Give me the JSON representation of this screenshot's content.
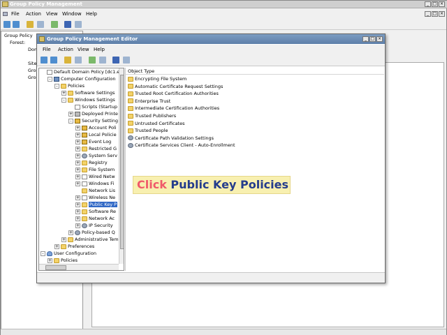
{
  "outer": {
    "title": "Group Policy Management",
    "menu": [
      "File",
      "Action",
      "View",
      "Window",
      "Help"
    ],
    "tree": [
      "Group Policy",
      "Forest:",
      "Dom",
      "Sites",
      "Grou",
      "Grou"
    ]
  },
  "editor": {
    "title": "Group Policy Management Editor",
    "menu": [
      "File",
      "Action",
      "View",
      "Help"
    ],
    "tree": [
      {
        "label": "Default Domain Policy [dc1.es-n",
        "icon": "doc",
        "exp": ""
      },
      {
        "label": "Computer Configuration",
        "icon": "pc",
        "exp": "-"
      },
      {
        "label": "Policies",
        "icon": "folder",
        "exp": "-"
      },
      {
        "label": "Software Settings",
        "icon": "folder",
        "exp": "+"
      },
      {
        "label": "Windows Settings",
        "icon": "folder",
        "exp": "-"
      },
      {
        "label": "Scripts (Startup",
        "icon": "doc",
        "exp": ""
      },
      {
        "label": "Deployed Printe",
        "icon": "printer",
        "exp": "+"
      },
      {
        "label": "Security Setting",
        "icon": "shield",
        "exp": "-"
      },
      {
        "label": "Account Poli",
        "icon": "shield",
        "exp": "+"
      },
      {
        "label": "Local Policie",
        "icon": "shield",
        "exp": "+"
      },
      {
        "label": "Event Log",
        "icon": "shield",
        "exp": "+"
      },
      {
        "label": "Restricted G",
        "icon": "folder",
        "exp": "+"
      },
      {
        "label": "System Serv",
        "icon": "gear",
        "exp": "+"
      },
      {
        "label": "Registry",
        "icon": "folder",
        "exp": "+"
      },
      {
        "label": "File System",
        "icon": "folder",
        "exp": "+"
      },
      {
        "label": "Wired Netw",
        "icon": "doc",
        "exp": "+"
      },
      {
        "label": "Windows Fi",
        "icon": "doc",
        "exp": "+"
      },
      {
        "label": "Network Lis",
        "icon": "folder",
        "exp": ""
      },
      {
        "label": "Wireless Ne",
        "icon": "doc",
        "exp": "+"
      },
      {
        "label": "Public Key P",
        "icon": "folder",
        "exp": "+",
        "selected": true
      },
      {
        "label": "Software Re",
        "icon": "folder",
        "exp": "+"
      },
      {
        "label": "Network Ac",
        "icon": "folder",
        "exp": "+"
      },
      {
        "label": "IP Security",
        "icon": "gear",
        "exp": "+"
      },
      {
        "label": "Policy-based Q",
        "icon": "gear",
        "exp": "+"
      },
      {
        "label": "Administrative Temp",
        "icon": "folder",
        "exp": "+"
      },
      {
        "label": "Preferences",
        "icon": "folder",
        "exp": "+"
      },
      {
        "label": "User Configuration",
        "icon": "user",
        "exp": "-"
      },
      {
        "label": "Policies",
        "icon": "folder",
        "exp": "+"
      }
    ],
    "list_header": "Object Type",
    "list_items": [
      {
        "label": "Encrypting File System",
        "icon": "folder"
      },
      {
        "label": "Automatic Certificate Request Settings",
        "icon": "folder"
      },
      {
        "label": "Trusted Root Certification Authorities",
        "icon": "folder"
      },
      {
        "label": "Enterprise Trust",
        "icon": "folder"
      },
      {
        "label": "Intermediate Certification Authorities",
        "icon": "folder"
      },
      {
        "label": "Trusted Publishers",
        "icon": "folder"
      },
      {
        "label": "Untrusted Certificates",
        "icon": "folder"
      },
      {
        "label": "Trusted People",
        "icon": "folder"
      },
      {
        "label": "Certificate Path Validation Settings",
        "icon": "gear"
      },
      {
        "label": "Certificate Services Client - Auto-Enrollment",
        "icon": "gear"
      }
    ]
  },
  "callout": {
    "action": "Click",
    "target": "Public Key Policies"
  }
}
